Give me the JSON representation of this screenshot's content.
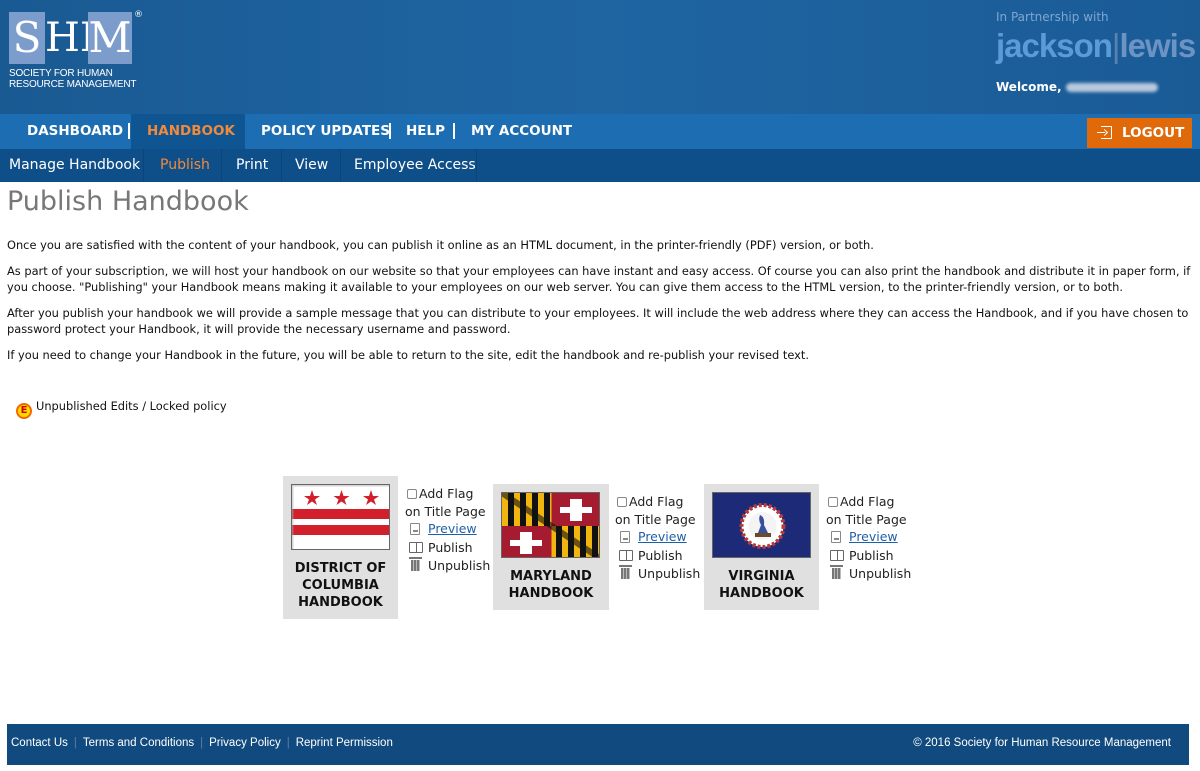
{
  "header": {
    "logo": {
      "letters": [
        "S",
        "HR",
        "M"
      ],
      "registered": "®",
      "line1": "SOCIETY FOR HUMAN",
      "line2": "RESOURCE MANAGEMENT"
    },
    "partner_label": "In Partnership with",
    "partner_brand": {
      "part1": "jackson",
      "separator": "|",
      "part2": "lewis"
    },
    "welcome_label": "Welcome,"
  },
  "main_nav": {
    "items": [
      {
        "label": "DASHBOARD",
        "active": false
      },
      {
        "label": "HANDBOOK",
        "active": true
      },
      {
        "label": "POLICY UPDATES",
        "active": false
      },
      {
        "label": "HELP",
        "active": false
      },
      {
        "label": "MY ACCOUNT",
        "active": false
      }
    ],
    "logout_label": "LOGOUT",
    "logout_icon": "logout-icon"
  },
  "sub_nav": {
    "items": [
      {
        "label": "Manage Handbook",
        "active": false
      },
      {
        "label": "Publish",
        "active": true
      },
      {
        "label": "Print",
        "active": false
      },
      {
        "label": "View",
        "active": false
      },
      {
        "label": "Employee Access",
        "active": false
      }
    ]
  },
  "content": {
    "title": "Publish Handbook",
    "paragraphs": [
      "Once you are satisfied with the content of your handbook, you can publish it online as an HTML document, in the printer-friendly (PDF) version, or both.",
      "As part of your subscription, we will host your handbook on our website so that your employees can have instant and easy access. Of course you can also print the handbook and distribute it in paper form, if you choose. \"Publishing\" your Handbook means making it available to your employees on our web server. You can give them access to the HTML version, to the printer-friendly version, or to both.",
      "After you publish your handbook we will provide a sample message that you can distribute to your employees. It will include the web address where they can access the Handbook, and if you have chosen to password protect your Handbook, it will provide the necessary username and password.",
      "If you need to change your Handbook in the future, you will be able to return to the site, edit the handbook and re-publish your revised text."
    ],
    "legend": {
      "badge": "E",
      "label": "Unpublished Edits / Locked policy",
      "badge_colors": {
        "fill": "#ffd800",
        "border": "#f06a00",
        "text": "#d10000"
      }
    }
  },
  "handbooks": [
    {
      "name_lines": [
        "DISTRICT OF",
        "COLUMBIA",
        "HANDBOOK"
      ],
      "flag": "dc-flag",
      "add_flag_line1": "Add Flag",
      "add_flag_line2": "on Title Page",
      "add_flag_checked": false,
      "preview": "Preview",
      "publish": "Publish",
      "unpublish": "Unpublish"
    },
    {
      "name_lines": [
        "MARYLAND",
        "HANDBOOK"
      ],
      "flag": "maryland-flag",
      "add_flag_line1": "Add Flag",
      "add_flag_line2": "on Title Page",
      "add_flag_checked": false,
      "preview": "Preview",
      "publish": "Publish",
      "unpublish": "Unpublish"
    },
    {
      "name_lines": [
        "VIRGINIA",
        "HANDBOOK"
      ],
      "flag": "virginia-flag",
      "add_flag_line1": "Add Flag",
      "add_flag_line2": "on Title Page",
      "add_flag_checked": false,
      "preview": "Preview",
      "publish": "Publish",
      "unpublish": "Unpublish"
    }
  ],
  "footer": {
    "links": [
      "Contact Us",
      "Terms and Conditions",
      "Privacy Policy",
      "Reprint Permission"
    ],
    "copyright": "© 2016 Society for Human Resource Management"
  },
  "colors": {
    "accent_orange": "#e06a0a",
    "active_nav_text": "#f28a3c",
    "nav_blue": "#1c6db1",
    "subnav_blue": "#0f4f89",
    "footer_blue": "#114a7e",
    "link_blue": "#1f5fa8"
  }
}
